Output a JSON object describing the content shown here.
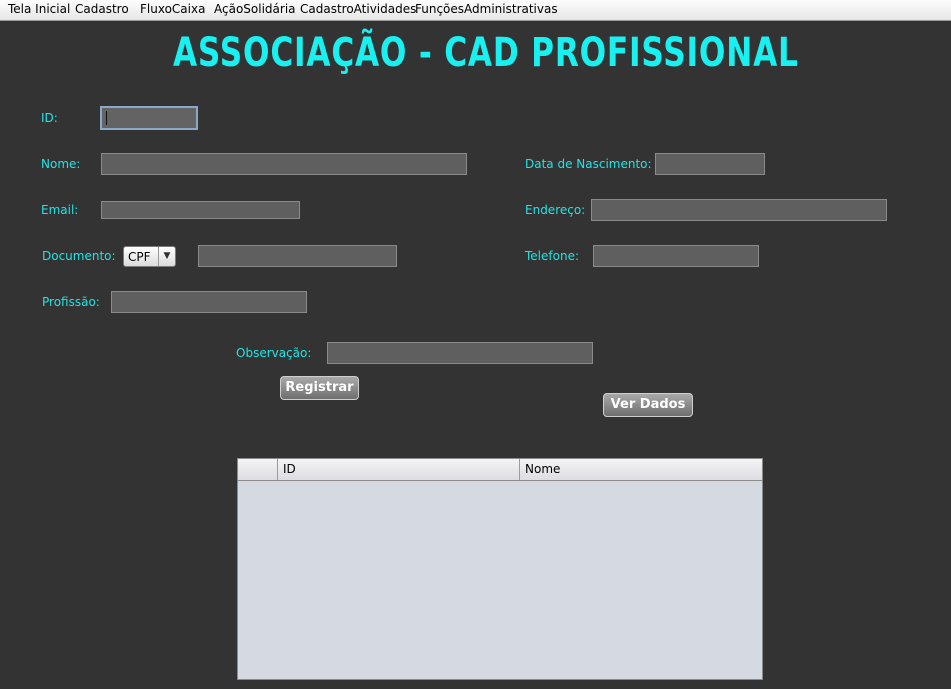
{
  "menu": {
    "items": [
      "Tela Inicial",
      "Cadastro",
      "FluxoCaixa",
      "AçãoSolidária",
      "CadastroAtividades",
      "FunçõesAdministrativas"
    ]
  },
  "title": "ASSOCIAÇÃO - CAD PROFISSIONAL",
  "form": {
    "id_label": "ID:",
    "id_value": "",
    "nome_label": "Nome:",
    "nome_value": "",
    "nascimento_label": "Data de Nascimento:",
    "nascimento_value": "",
    "email_label": "Email:",
    "email_value": "",
    "endereco_label": "Endereço:",
    "endereco_value": "",
    "documento_label": "Documento:",
    "documento_type": "CPF",
    "documento_value": "",
    "telefone_label": "Telefone:",
    "telefone_value": "",
    "profissao_label": "Profissão:",
    "profissao_value": "",
    "observacao_label": "Observação:",
    "observacao_value": ""
  },
  "buttons": {
    "registrar": "Registrar",
    "ver_dados": "Ver Dados"
  },
  "table": {
    "columns": [
      "",
      "ID",
      "Nome"
    ],
    "rows": []
  },
  "colors": {
    "background": "#333333",
    "accent": "#19f0f0",
    "label": "#22e4e4",
    "field": "#5f5f5f"
  }
}
